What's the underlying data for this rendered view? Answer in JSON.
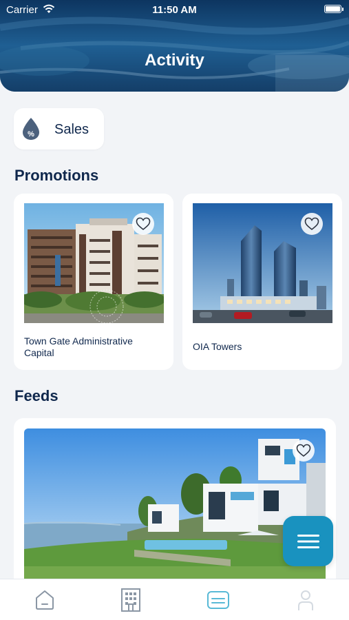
{
  "status_bar": {
    "carrier": "Carrier",
    "time": "11:50 AM"
  },
  "header": {
    "title": "Activity"
  },
  "sales_chip": {
    "label": "Sales",
    "icon": "percent-drop-icon"
  },
  "promotions": {
    "title": "Promotions",
    "items": [
      {
        "caption": "Town Gate Administrative Capital",
        "favorited": false
      },
      {
        "caption": "OIA Towers",
        "favorited": false
      }
    ]
  },
  "feeds": {
    "title": "Feeds",
    "items": [
      {
        "favorited": false
      }
    ]
  },
  "tab_bar": {
    "items": [
      {
        "icon": "home-icon",
        "active": false
      },
      {
        "icon": "building-icon",
        "active": false
      },
      {
        "icon": "activity-card-icon",
        "active": true
      },
      {
        "icon": "profile-icon",
        "active": false
      }
    ]
  },
  "colors": {
    "accent": "#1992bf",
    "title_text": "#10284d",
    "background": "#f2f4f7",
    "tab_active": "#58b9d6",
    "tab_inactive": "#8a96a4"
  }
}
